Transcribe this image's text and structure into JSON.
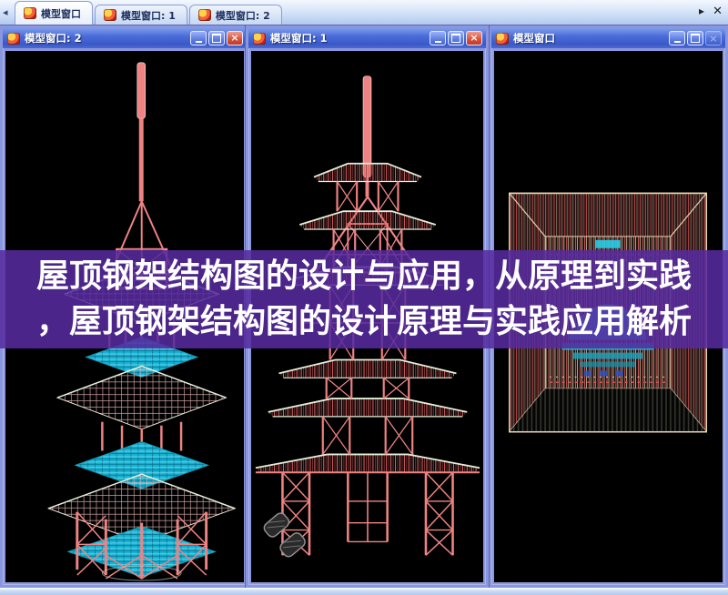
{
  "tab_bar": {
    "scroll_left": "◂",
    "scroll_right": "▸",
    "close": "✕",
    "tabs": [
      {
        "label": "模型窗口",
        "active": true
      },
      {
        "label": "模型窗口: 1",
        "active": false
      },
      {
        "label": "模型窗口: 2",
        "active": false
      }
    ]
  },
  "windows": {
    "left": {
      "title": "模型窗口: 2",
      "view": "perspective-wireframe-pagoda",
      "buttons": [
        "minimize",
        "maximize"
      ],
      "close_glyph": "×"
    },
    "middle": {
      "title": "模型窗口: 1",
      "view": "front-elevation-wireframe-pagoda",
      "buttons": [
        "minimize",
        "maximize",
        "close"
      ],
      "close_glyph": "×"
    },
    "right": {
      "title": "模型窗口",
      "view": "top-plan-wireframe-pagoda",
      "buttons": [
        "minimize",
        "maximize",
        "close-disabled"
      ],
      "close_glyph": "×"
    }
  },
  "banner": {
    "line1": "屋顶钢架结构图的设计与应用，从原理到实践",
    "line2": "，屋顶钢架结构图的设计原理与实践应用解析",
    "bg_color": "#562A9E",
    "text_color": "#FFFFFF"
  },
  "colors": {
    "viewport_bg": "#000000",
    "structure_red": "#EF8383",
    "roof_grid_pink": "#EDB6B6",
    "roof_edge_light": "#E2EFDA",
    "deck_cyan": "#17B2D4",
    "plan_outline_cream": "#E6D8B0",
    "plan_hatch_red": "#B84848",
    "titlebar_blue": "#4A6CD8",
    "window_border": "#8A97DD",
    "tabbar_bg": "#B2C9EE"
  }
}
